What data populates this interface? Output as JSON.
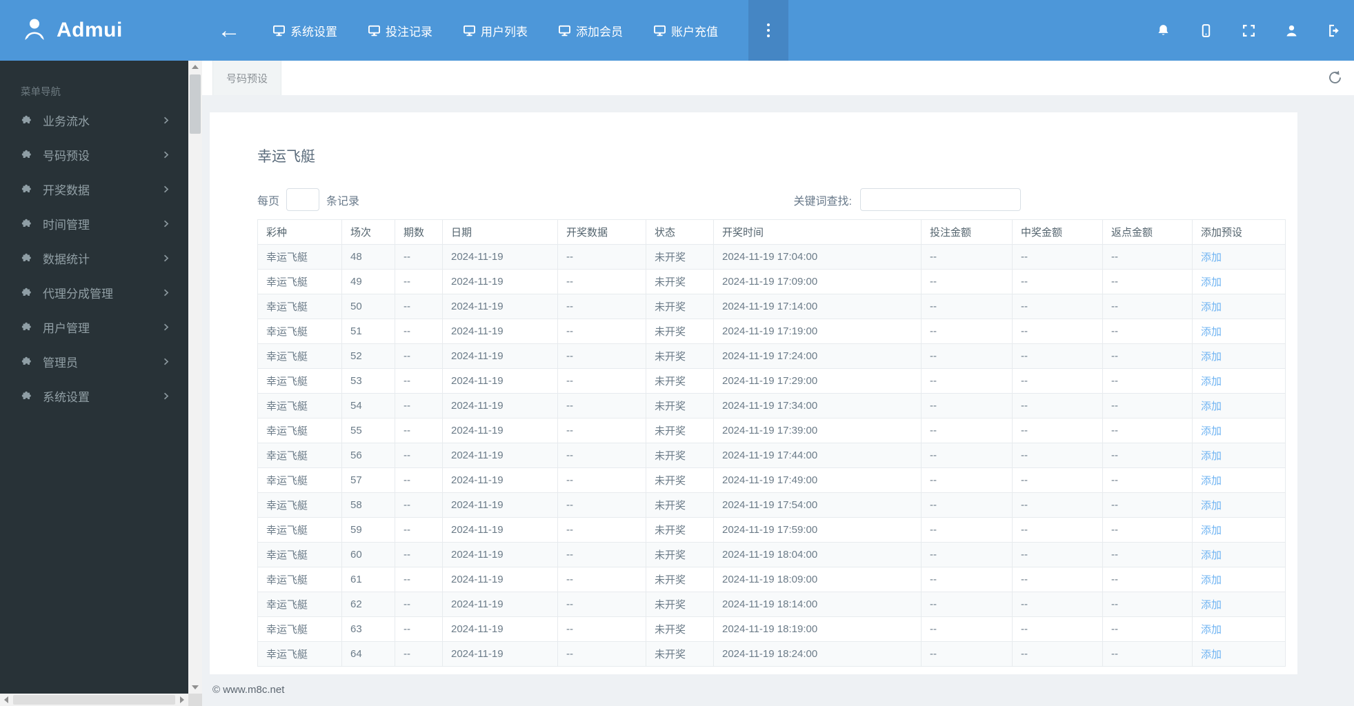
{
  "navbar": {
    "brand": "Admui",
    "items": [
      {
        "label": "系统设置"
      },
      {
        "label": "投注记录"
      },
      {
        "label": "用户列表"
      },
      {
        "label": "添加会员"
      },
      {
        "label": "账户充值"
      }
    ],
    "right_icons": [
      "bell",
      "mobile",
      "fullscreen",
      "user",
      "logout"
    ]
  },
  "sidebar": {
    "section_title": "菜单导航",
    "items": [
      {
        "label": "业务流水"
      },
      {
        "label": "号码预设"
      },
      {
        "label": "开奖数据"
      },
      {
        "label": "时间管理"
      },
      {
        "label": "数据统计"
      },
      {
        "label": "代理分成管理"
      },
      {
        "label": "用户管理"
      },
      {
        "label": "管理员"
      },
      {
        "label": "系统设置"
      }
    ]
  },
  "tabs": {
    "active": "号码预设"
  },
  "content": {
    "title": "幸运飞艇",
    "per_page": {
      "prefix": "每页",
      "suffix": "条记录",
      "value": ""
    },
    "search": {
      "label": "关键词查找:",
      "value": ""
    }
  },
  "table": {
    "columns": [
      "彩种",
      "场次",
      "期数",
      "日期",
      "开奖数据",
      "状态",
      "开奖时间",
      "投注金额",
      "中奖金额",
      "返点金额",
      "添加预设"
    ],
    "rows": [
      [
        "幸运飞艇",
        "48",
        "--",
        "2024-11-19",
        "--",
        "未开奖",
        "2024-11-19 17:04:00",
        "--",
        "--",
        "--",
        "添加"
      ],
      [
        "幸运飞艇",
        "49",
        "--",
        "2024-11-19",
        "--",
        "未开奖",
        "2024-11-19 17:09:00",
        "--",
        "--",
        "--",
        "添加"
      ],
      [
        "幸运飞艇",
        "50",
        "--",
        "2024-11-19",
        "--",
        "未开奖",
        "2024-11-19 17:14:00",
        "--",
        "--",
        "--",
        "添加"
      ],
      [
        "幸运飞艇",
        "51",
        "--",
        "2024-11-19",
        "--",
        "未开奖",
        "2024-11-19 17:19:00",
        "--",
        "--",
        "--",
        "添加"
      ],
      [
        "幸运飞艇",
        "52",
        "--",
        "2024-11-19",
        "--",
        "未开奖",
        "2024-11-19 17:24:00",
        "--",
        "--",
        "--",
        "添加"
      ],
      [
        "幸运飞艇",
        "53",
        "--",
        "2024-11-19",
        "--",
        "未开奖",
        "2024-11-19 17:29:00",
        "--",
        "--",
        "--",
        "添加"
      ],
      [
        "幸运飞艇",
        "54",
        "--",
        "2024-11-19",
        "--",
        "未开奖",
        "2024-11-19 17:34:00",
        "--",
        "--",
        "--",
        "添加"
      ],
      [
        "幸运飞艇",
        "55",
        "--",
        "2024-11-19",
        "--",
        "未开奖",
        "2024-11-19 17:39:00",
        "--",
        "--",
        "--",
        "添加"
      ],
      [
        "幸运飞艇",
        "56",
        "--",
        "2024-11-19",
        "--",
        "未开奖",
        "2024-11-19 17:44:00",
        "--",
        "--",
        "--",
        "添加"
      ],
      [
        "幸运飞艇",
        "57",
        "--",
        "2024-11-19",
        "--",
        "未开奖",
        "2024-11-19 17:49:00",
        "--",
        "--",
        "--",
        "添加"
      ],
      [
        "幸运飞艇",
        "58",
        "--",
        "2024-11-19",
        "--",
        "未开奖",
        "2024-11-19 17:54:00",
        "--",
        "--",
        "--",
        "添加"
      ],
      [
        "幸运飞艇",
        "59",
        "--",
        "2024-11-19",
        "--",
        "未开奖",
        "2024-11-19 17:59:00",
        "--",
        "--",
        "--",
        "添加"
      ],
      [
        "幸运飞艇",
        "60",
        "--",
        "2024-11-19",
        "--",
        "未开奖",
        "2024-11-19 18:04:00",
        "--",
        "--",
        "--",
        "添加"
      ],
      [
        "幸运飞艇",
        "61",
        "--",
        "2024-11-19",
        "--",
        "未开奖",
        "2024-11-19 18:09:00",
        "--",
        "--",
        "--",
        "添加"
      ],
      [
        "幸运飞艇",
        "62",
        "--",
        "2024-11-19",
        "--",
        "未开奖",
        "2024-11-19 18:14:00",
        "--",
        "--",
        "--",
        "添加"
      ],
      [
        "幸运飞艇",
        "63",
        "--",
        "2024-11-19",
        "--",
        "未开奖",
        "2024-11-19 18:19:00",
        "--",
        "--",
        "--",
        "添加"
      ],
      [
        "幸运飞艇",
        "64",
        "--",
        "2024-11-19",
        "--",
        "未开奖",
        "2024-11-19 18:24:00",
        "--",
        "--",
        "--",
        "添加"
      ]
    ]
  },
  "footer": {
    "copyright": "© www.m8c.net"
  },
  "colors": {
    "navbar_blue": "#4d97d9",
    "navbar_more_blue": "#4586c4",
    "sidebar_dark": "#283237",
    "content_bg": "#eef1f4",
    "table_border": "#e7ebee",
    "stripe_bg": "#f8fafb",
    "link_blue": "#6eb3f2",
    "text_gray": "#6b7b88"
  }
}
